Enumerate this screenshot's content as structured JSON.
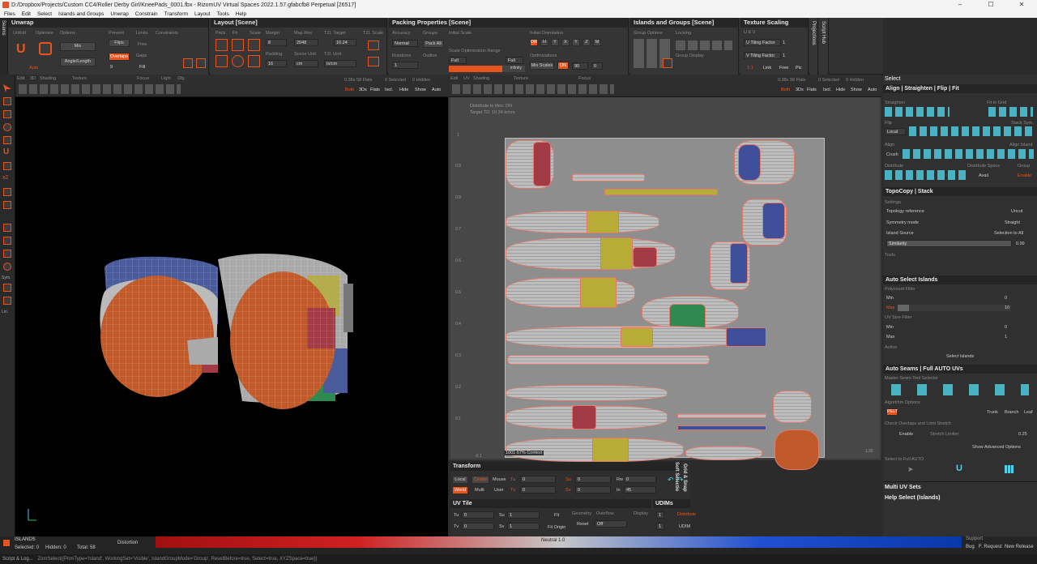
{
  "window": {
    "title": "D:/Dropbox/Projects/Custom CC4/Roller Derby Girl/KneePads_0001.fbx - RizomUV  Virtual Spaces 2022.1.57.gfabcfb8 Perpetual  [26517]",
    "min": "–",
    "max": "☐",
    "close": "✕"
  },
  "menu": [
    "Files",
    "Edit",
    "Select",
    "Islands and Groups",
    "Unwrap",
    "Constrain",
    "Transform",
    "Layout",
    "Tools",
    "Help"
  ],
  "panels": {
    "unwrap": {
      "title": "Unwrap",
      "unfold": "Unfold",
      "optimize": "Optimize",
      "options": "Options",
      "mix": "Mix",
      "angle_length": "Angle/Length",
      "auto": "Auto",
      "prevent": "Prevent",
      "flips": "Flips",
      "overlaps": "Overlaps",
      "limits": "Limits",
      "free": "Free",
      "gaps": "Gaps",
      "fill": "Fill",
      "constraints": "Constraints",
      "nine": "9"
    },
    "layout": {
      "title": "Layout [Scene]",
      "pack": "Pack",
      "fit": "Fit",
      "scale": "Scale",
      "margin": "Margin",
      "margin_v": "8",
      "map_res": "Map Res",
      "map_res_v": "2048",
      "td_target": "T.D. Target",
      "td_target_v": "10.24",
      "td_scale": "T.D. Scale",
      "padding": "Padding",
      "padding_v": "16",
      "scene_unit": "Scene Unit",
      "scene_unit_v": "cm",
      "td_unit": "T.D. Unit",
      "td_unit_v": "tx/cm"
    },
    "packing": {
      "title": "Packing Properties [Scene]",
      "accuracy": "Accuracy",
      "accuracy_v": "Normal",
      "groups": "Groups",
      "pack_all": "Pack All",
      "rotations": "Rotations",
      "rotations_v": "1",
      "outline": "Outline",
      "initial_scale": "Initial Scale",
      "scale_opt": "Scale Optimization Range",
      "full": "Full",
      "initial_orientation": "Initial Orientation",
      "orientations": [
        "OR",
        "H",
        "Y",
        "X",
        "Y",
        "Z",
        "M"
      ],
      "optimizations": "Optimizations",
      "mix_scales": "Mix Scales",
      "on": "ON",
      "ninety": "90",
      "zero": "0",
      "infinity": "Infinity"
    },
    "islands": {
      "title": "Islands and Groups [Scene]",
      "group_options": "Group Options",
      "locking": "Locking",
      "group_display": "Group Display"
    },
    "texture": {
      "title": "Texture Scaling",
      "uvs": "U & V",
      "u_tiling": "U Tiling Factor",
      "u_tiling_v": "1",
      "v_tiling": "V Tiling Factor",
      "v_tiling_v": "1",
      "ratio": "1:1",
      "link": "Link",
      "free": "Free",
      "pic": "Pic"
    },
    "side": {
      "seams": "Seams",
      "projections": "Projections",
      "script_hub": "Script Hub"
    }
  },
  "viewport3d": {
    "edit": "Edit",
    "uv": "3D",
    "shading": "Shading",
    "texture": "Texture",
    "focus": "Focus",
    "light": "Light",
    "obj": "Obj",
    "islands": "0.38s 58 Flats",
    "selected": "0 Selected",
    "hidden": "0 Hidden",
    "both": "Both",
    "v3ds": "3Ds",
    "flats": "Flats",
    "isol": "Isol.",
    "hide": "Hide",
    "show": "Show",
    "auto": "Auto",
    "labels_left": [
      "Sym.",
      "Lin."
    ],
    "x2": "x2"
  },
  "viewportuv": {
    "edit": "Edit",
    "uv": "UV",
    "shading": "Shading",
    "texture": "Texture",
    "focus": "Focus",
    "islands": "0.38s 58 Flats",
    "selected": "0 Selected",
    "hidden": "0 Hidden",
    "both": "Both",
    "v3ds": "3Ds",
    "flats": "Flats",
    "isol": "Isol.",
    "hide": "Hide",
    "show": "Show",
    "auto": "Auto",
    "info1": "Distribute to tiles: ON",
    "info2": "Target TD: 10.24 tx/cm",
    "tile": "1001",
    "ratio": "67%",
    "context": "Context",
    "yticks": [
      "1",
      "0.9",
      "0.8",
      "0.7",
      "0.6",
      "0.5",
      "0.4",
      "0.3",
      "0.2",
      "0.1",
      "-0.1"
    ],
    "corner": "1.05"
  },
  "right": {
    "select": "Select",
    "align": {
      "title": "Align | Straighten | Flip | Fit",
      "straighten": "Straighten",
      "fit_to_grid": "Fit to Grid",
      "flip": "Flip",
      "local": "Local",
      "stack_sym": "Stack Sym.",
      "align": "Align",
      "align_island": "Align Island",
      "crush": "Crush",
      "distribute": "Distribute",
      "dist_space": "Distribute Space",
      "group": "Group",
      "avail": "Avail.",
      "enable": "Enable"
    },
    "topo": {
      "title": "TopoCopy | Stack",
      "settings": "Settings",
      "topo_ref": "Topology reference",
      "topo_ref_v": "Uncut",
      "sym_mode": "Symmetry mode",
      "sym_mode_v": "Straight",
      "island_source": "Island Source",
      "island_source_v": "Selection to All",
      "similarity": "Similarity",
      "similarity_v": "0.99",
      "tools": "Tools"
    },
    "autosel": {
      "title": "Auto Select Islands",
      "poly": "Polycount Filter",
      "min": "Min",
      "min_v": "0",
      "max": "Max",
      "max_v": "10",
      "uvsize": "UV Size Filter",
      "min2": "Min",
      "min2_v": "0",
      "max2": "Max",
      "max2_v": "1",
      "action": "Action",
      "select": "Select Islands"
    },
    "seams": {
      "title": "Auto Seams | Full AUTO UVs",
      "master": "Master Seam Tool Selector",
      "algo": "Algorithm Options",
      "pelt": "PELT",
      "trunk": "Trunk",
      "branch": "Branch",
      "leaf": "Leaf",
      "check": "Check Overlaps and Limit Stretch",
      "enable": "Enable",
      "stretch": "Stretch Limiter",
      "stretch_v": "0.25",
      "show_adv": "Show Advanced Options",
      "select_full": "Select to Full AUTO"
    },
    "multi": "Multi UV Sets",
    "help": "Help Select (Islands)"
  },
  "transform": {
    "title": "Transform",
    "local": "Local",
    "center": "Center",
    "mouse": "Mouse",
    "tu": "Tu",
    "tu_v": "0",
    "su": "Su",
    "su_v": "0",
    "rw": "Rw",
    "rw_v": "0",
    "world": "World",
    "multi": "Multi",
    "user": "User",
    "tv": "Tv",
    "tv_v": "0",
    "sv": "Sv",
    "sv_v": "0",
    "in": "In",
    "in_v": "45",
    "grid": "Grid & Snap",
    "soft": "Soft Selectio"
  },
  "uvtile": {
    "title": "UV Tile",
    "tu": "Tu",
    "tu_v": "0",
    "su": "Su",
    "su_v": "1",
    "fit": "Fit",
    "tv": "Tv",
    "tv_v": "0",
    "sv": "Sv",
    "sv_v": "1",
    "fit_origin": "Fit Origin",
    "geometry": "Geometry",
    "overflow": "Overflow",
    "reset": "Reset",
    "off": "Off",
    "display": "Display",
    "udims": "UDIMs",
    "udim_v": "1",
    "udim_v2": "1",
    "distribute": "Distribute",
    "udim": "UDIM"
  },
  "bottom": {
    "islands": "ISLANDS",
    "selected": "Selected: 0",
    "hidden": "Hidden: 0",
    "total": "Total: 58",
    "distortion": "Distortion",
    "neutral": "Neutral 1.0",
    "support": "Support",
    "bug": "Bug",
    "feature": "F. Request",
    "release": "New Release"
  },
  "status": {
    "script": "Script & Log...",
    "cmd": "ZomSelect({PrimType='Island', WorkingSet='Visible', IslandGroupMode='Group', ResetBefore=true, Select=true, XYZSpace=true})"
  },
  "colors": {
    "accent": "#e8541e",
    "cyan": "#4fd2e8"
  }
}
